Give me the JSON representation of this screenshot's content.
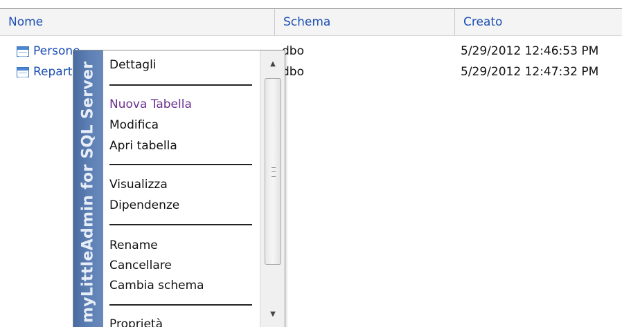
{
  "columns": {
    "name": "Nome",
    "schema": "Schema",
    "created": "Creato"
  },
  "rows": [
    {
      "name": "Persone",
      "schema": "dbo",
      "created": "5/29/2012 12:46:53 PM",
      "icon": "table-icon"
    },
    {
      "name": "Reparti",
      "schema": "dbo",
      "created": "5/29/2012 12:47:32 PM",
      "icon": "table-icon"
    }
  ],
  "context_menu": {
    "side_label": "myLittleAdmin for SQL Server",
    "items": [
      {
        "label": "Dettagli"
      },
      {
        "label": "Nuova Tabella"
      },
      {
        "label": "Modifica"
      },
      {
        "label": "Apri tabella"
      },
      {
        "label": "Visualizza"
      },
      {
        "label": "Dipendenze"
      },
      {
        "label": "Rename"
      },
      {
        "label": "Cancellare"
      },
      {
        "label": "Cambia schema"
      },
      {
        "label": "Proprietà"
      }
    ]
  },
  "colors": {
    "link_blue": "#1d4fb3",
    "menu_side": "#5c7fb4",
    "accent_item": "#6b2f8f"
  }
}
